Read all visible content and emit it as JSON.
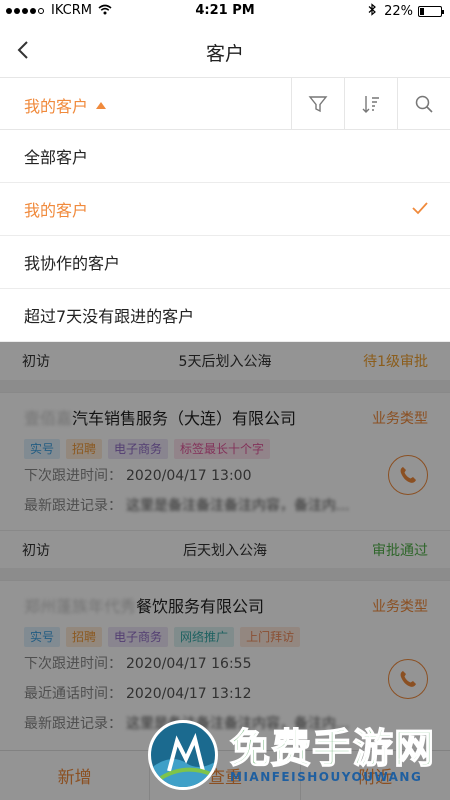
{
  "status_bar": {
    "carrier": "IKCRM",
    "time": "4:21 PM",
    "battery": "22%",
    "battery_level": 0.22
  },
  "nav": {
    "title": "客户"
  },
  "filter": {
    "scope_label": "我的客户"
  },
  "dropdown": {
    "options": [
      {
        "label": "全部客户",
        "selected": false
      },
      {
        "label": "我的客户",
        "selected": true
      },
      {
        "label": "我协作的客户",
        "selected": false
      },
      {
        "label": "超过7天没有跟进的客户",
        "selected": false
      }
    ]
  },
  "customers": [
    {
      "stage": "初访",
      "deadline": "5天后划入公海",
      "approval": "待1级审批",
      "approval_color": "#f0a030"
    },
    {
      "name_blur": "壹佰嘉",
      "name": "汽车销售服务（大连）有限公司",
      "type": "业务类型",
      "tags": [
        {
          "label": "实号",
          "style": "blue"
        },
        {
          "label": "招聘",
          "style": "orange"
        },
        {
          "label": "电子商务",
          "style": "purple"
        },
        {
          "label": "标签最长十个字",
          "style": "pink"
        }
      ],
      "next_followup_label": "下次跟进时间：",
      "next_followup_value": "2020/04/17  13:00",
      "latest_record_label": "最新跟进记录：",
      "latest_record_value": "这里是备注备注备注内容，备注内...",
      "stage": "初访",
      "deadline": "后天划入公海",
      "approval": "审批通过",
      "approval_color": "#52b04a"
    },
    {
      "name_blur": "郑州蓬族年代秀",
      "name": "餐饮服务有限公司",
      "type": "业务类型",
      "tags": [
        {
          "label": "实号",
          "style": "blue"
        },
        {
          "label": "招聘",
          "style": "orange"
        },
        {
          "label": "电子商务",
          "style": "purple"
        },
        {
          "label": "网络推广",
          "style": "teal"
        },
        {
          "label": "上门拜访",
          "style": "salmon"
        }
      ],
      "next_followup_label": "下次跟进时间：",
      "next_followup_value": "2020/04/17  16:55",
      "recent_call_label": "最近通话时间：",
      "recent_call_value": "2020/04/17  13:12",
      "latest_record_label": "最新跟进记录：",
      "latest_record_value": "这里是备注备注备注内容，备注内..."
    }
  ],
  "bottom_bar": {
    "add": "新增",
    "check_dup": "查重",
    "nearby": "附近"
  },
  "watermark": {
    "text": "免费手游网",
    "sub": "MIANFEISHOUYOUWANG"
  },
  "colors": {
    "accent": "#f08a3c"
  }
}
